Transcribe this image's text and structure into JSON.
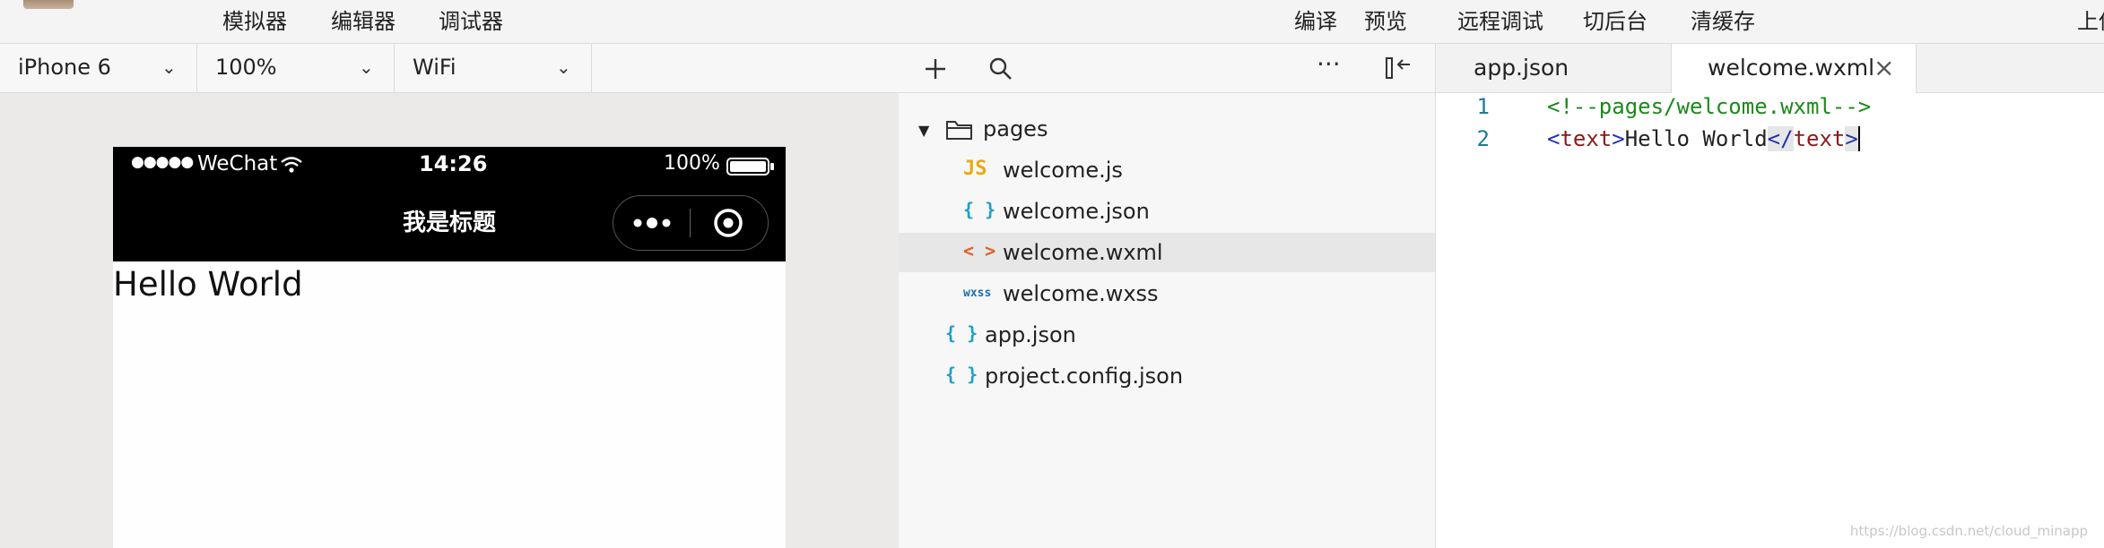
{
  "menu": {
    "left": [
      "模拟器",
      "编辑器",
      "调试器"
    ],
    "right": [
      "编译",
      "预览",
      "远程调试",
      "切后台",
      "清缓存",
      "上传"
    ]
  },
  "device_bar": {
    "device": "iPhone 6",
    "zoom": "100%",
    "network": "WiFi"
  },
  "phone": {
    "signal": "●●●●●",
    "carrier": "WeChat",
    "time": "14:26",
    "battery": "100%",
    "nav_title": "我是标题",
    "body_text": "Hello World"
  },
  "files": {
    "folder": "pages",
    "items": [
      {
        "icon": "JS",
        "name": "welcome.js",
        "color": "#e8a912"
      },
      {
        "icon": "{ }",
        "name": "welcome.json",
        "color": "#1ca0c9"
      },
      {
        "icon": "< >",
        "name": "welcome.wxml",
        "color": "#e0602a"
      },
      {
        "icon": "wxss",
        "name": "welcome.wxss",
        "color": "#1c6fb0"
      },
      {
        "icon": "{ }",
        "name": "app.json",
        "color": "#1ca0c9"
      },
      {
        "icon": "{ }",
        "name": "project.config.json",
        "color": "#1ca0c9"
      }
    ]
  },
  "editor": {
    "tabs": [
      "app.json",
      "welcome.wxml"
    ],
    "active_tab": "welcome.wxml",
    "lines": [
      {
        "num": "1",
        "comment": "<!--pages/welcome.wxml-->"
      },
      {
        "num": "2",
        "open": "<",
        "tag_open": "text",
        "close_br": ">",
        "content": "Hello World",
        "end_open": "</",
        "tag_close": "text",
        "end_close": ">"
      }
    ]
  },
  "watermark": "https://blog.csdn.net/cloud_minapp"
}
